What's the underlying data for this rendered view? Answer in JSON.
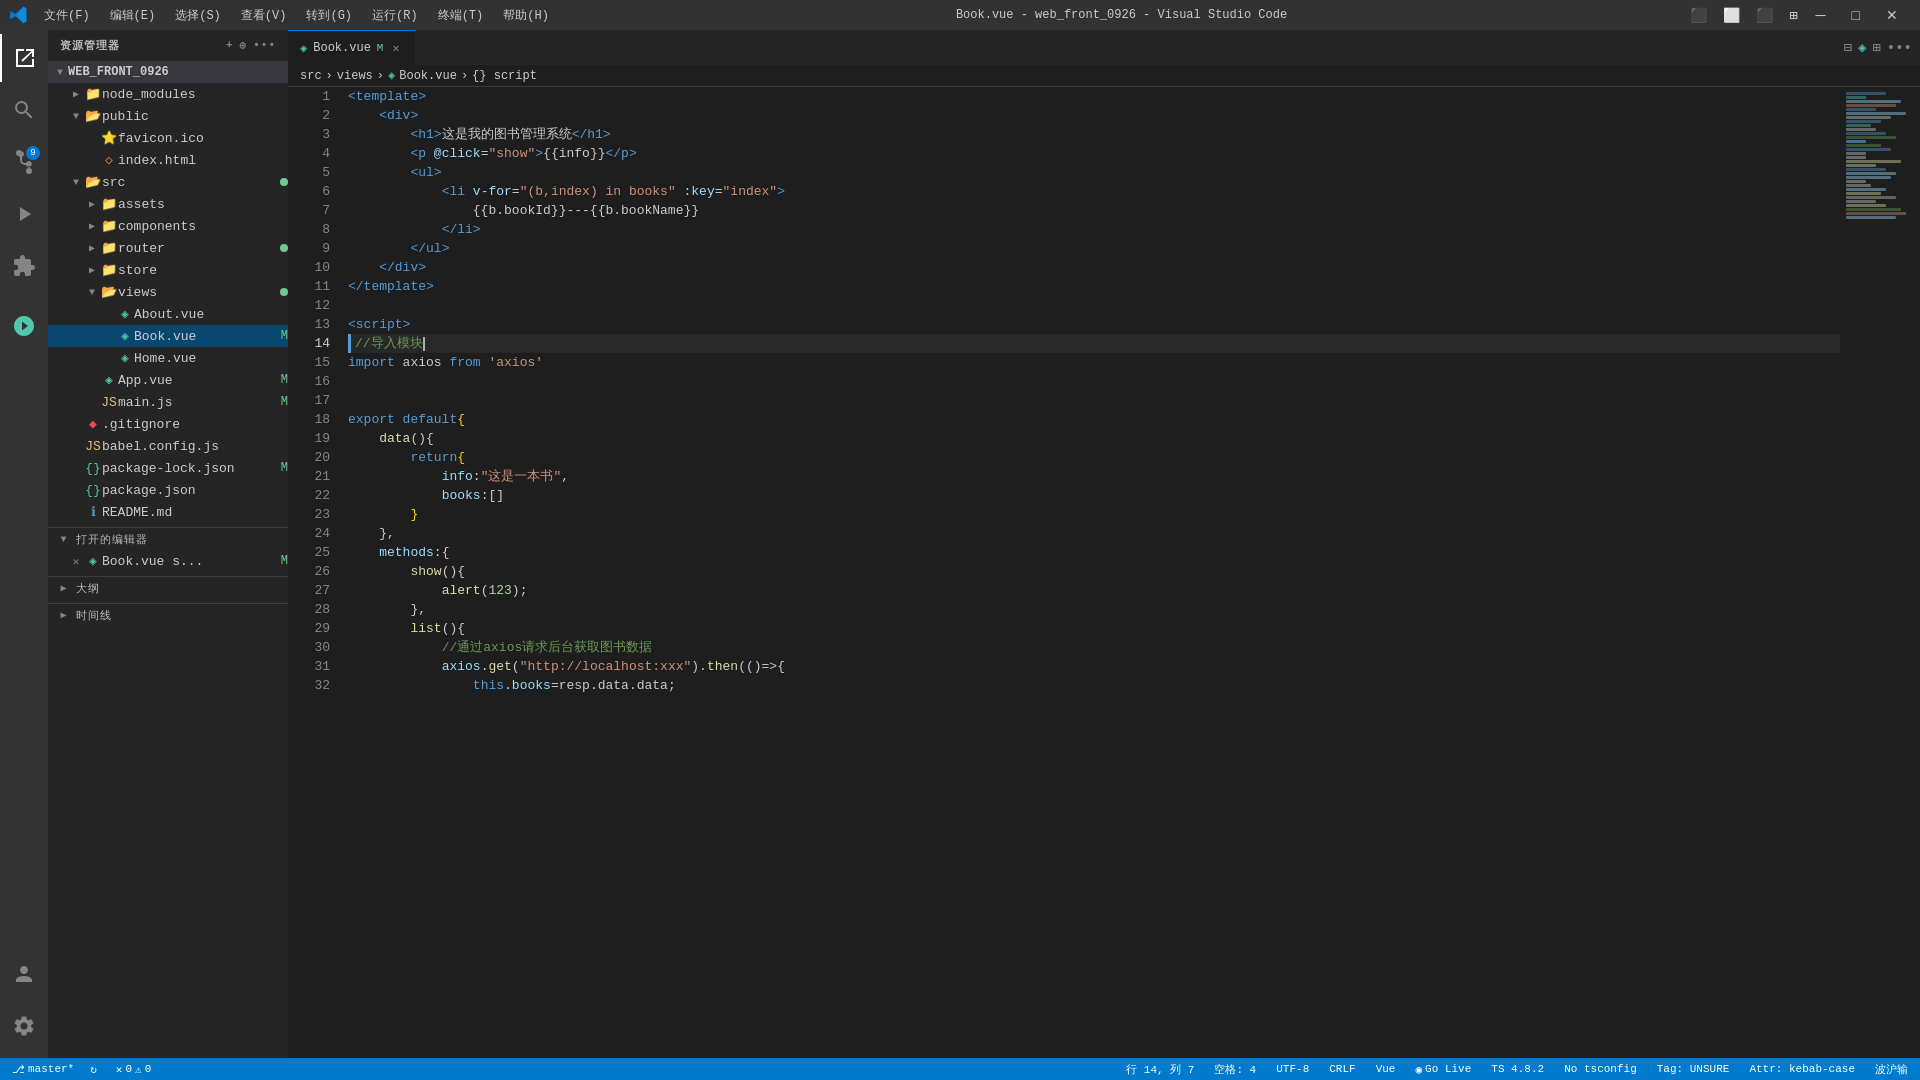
{
  "titlebar": {
    "title": "Book.vue - web_front_0926 - Visual Studio Code",
    "menu": [
      "文件(F)",
      "编辑(E)",
      "选择(S)",
      "查看(V)",
      "转到(G)",
      "运行(R)",
      "终端(T)",
      "帮助(H)"
    ]
  },
  "sidebar": {
    "header": "资源管理器",
    "root": "WEB_FRONT_0926",
    "items": [
      {
        "label": "node_modules",
        "type": "folder",
        "collapsed": true,
        "indent": 1
      },
      {
        "label": "public",
        "type": "folder",
        "collapsed": false,
        "indent": 1
      },
      {
        "label": "favicon.ico",
        "type": "file-ico",
        "indent": 2
      },
      {
        "label": "index.html",
        "type": "file-html",
        "indent": 2
      },
      {
        "label": "src",
        "type": "folder",
        "collapsed": false,
        "indent": 1,
        "modified": true
      },
      {
        "label": "assets",
        "type": "folder",
        "collapsed": true,
        "indent": 2
      },
      {
        "label": "components",
        "type": "folder",
        "collapsed": true,
        "indent": 2
      },
      {
        "label": "router",
        "type": "folder",
        "collapsed": true,
        "indent": 2,
        "modified": true
      },
      {
        "label": "store",
        "type": "folder",
        "collapsed": true,
        "indent": 2
      },
      {
        "label": "views",
        "type": "folder",
        "collapsed": false,
        "indent": 2,
        "modified": true
      },
      {
        "label": "About.vue",
        "type": "file-vue",
        "indent": 3
      },
      {
        "label": "Book.vue",
        "type": "file-vue",
        "indent": 3,
        "active": true,
        "badge": "M"
      },
      {
        "label": "Home.vue",
        "type": "file-vue",
        "indent": 3
      },
      {
        "label": "App.vue",
        "type": "file-vue",
        "indent": 2,
        "badge": "M"
      },
      {
        "label": "main.js",
        "type": "file-js",
        "indent": 2,
        "badge": "M"
      },
      {
        "label": ".gitignore",
        "type": "file-git",
        "indent": 1
      },
      {
        "label": "babel.config.js",
        "type": "file-js",
        "indent": 1
      },
      {
        "label": "package-lock.json",
        "type": "file-json",
        "indent": 1,
        "badge": "M"
      },
      {
        "label": "package.json",
        "type": "file-json",
        "indent": 1
      },
      {
        "label": "README.md",
        "type": "file-md",
        "indent": 1
      }
    ]
  },
  "open_editors": {
    "header": "打开的编辑器",
    "items": [
      {
        "label": "Book.vue s...",
        "badge": "M",
        "type": "file-vue"
      }
    ]
  },
  "outline": {
    "header": "大纲"
  },
  "timeline": {
    "header": "时间线"
  },
  "tab": {
    "label": "Book.vue",
    "badge": "M"
  },
  "breadcrumb": {
    "parts": [
      "src",
      ">",
      "views",
      ">",
      "Book.vue",
      ">",
      "{} script"
    ]
  },
  "code": {
    "lines": [
      {
        "num": 1,
        "content": "<template>"
      },
      {
        "num": 2,
        "content": "    <div>"
      },
      {
        "num": 3,
        "content": "        <h1>这是我的图书管理系统</h1>"
      },
      {
        "num": 4,
        "content": "        <p @click=\"show\">{{info}}</p>"
      },
      {
        "num": 5,
        "content": "        <ul>"
      },
      {
        "num": 6,
        "content": "            <li v-for=\"(b,index) in books\" :key=\"index\">"
      },
      {
        "num": 7,
        "content": "                {{b.bookId}}---{{b.bookName}}"
      },
      {
        "num": 8,
        "content": "            </li>"
      },
      {
        "num": 9,
        "content": "        </ul>"
      },
      {
        "num": 10,
        "content": "    </div>"
      },
      {
        "num": 11,
        "content": "</template>"
      },
      {
        "num": 12,
        "content": ""
      },
      {
        "num": 13,
        "content": "<script>"
      },
      {
        "num": 14,
        "content": "//导入模块",
        "current": true
      },
      {
        "num": 15,
        "content": "import axios from 'axios'"
      },
      {
        "num": 16,
        "content": ""
      },
      {
        "num": 17,
        "content": ""
      },
      {
        "num": 18,
        "content": "export default{"
      },
      {
        "num": 19,
        "content": "    data(){"
      },
      {
        "num": 20,
        "content": "        return{"
      },
      {
        "num": 21,
        "content": "            info:\"这是一本书\","
      },
      {
        "num": 22,
        "content": "            books:[]"
      },
      {
        "num": 23,
        "content": "        }"
      },
      {
        "num": 24,
        "content": "    },"
      },
      {
        "num": 25,
        "content": "    methods:{"
      },
      {
        "num": 26,
        "content": "        show(){"
      },
      {
        "num": 27,
        "content": "            alert(123);"
      },
      {
        "num": 28,
        "content": "        },"
      },
      {
        "num": 29,
        "content": "        list(){"
      },
      {
        "num": 30,
        "content": "            //通过axios请求后台获取图书数据"
      },
      {
        "num": 31,
        "content": "            axios.get(\"http://localhost:xxx\").then(()=>{"
      },
      {
        "num": 32,
        "content": "                this.books=resp.data.data;"
      }
    ]
  },
  "statusbar": {
    "branch": "master*",
    "sync": "",
    "errors": "0",
    "warnings": "0",
    "line_col": "行 14, 列 7",
    "spaces": "空格: 4",
    "encoding": "UTF-8",
    "line_ending": "CRLF",
    "language": "Vue",
    "go_live": "Go Live",
    "ts_version": "TS 4.8.2",
    "no_tsconfig": "No tsconfig",
    "tag": "Tag: UNSURE",
    "attr": "Attr: kebab-case",
    "extra": "波沪输"
  }
}
